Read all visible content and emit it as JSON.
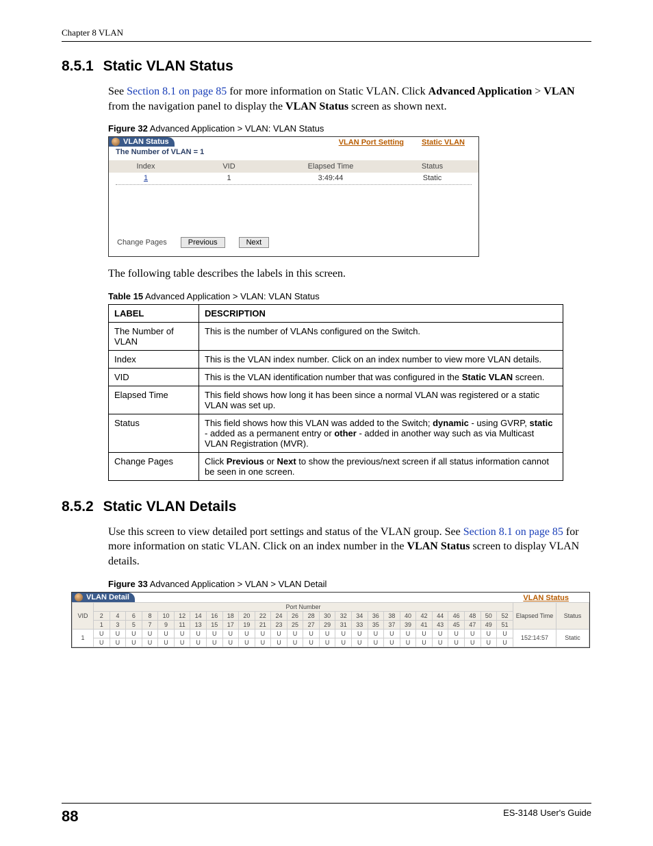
{
  "header": {
    "chapter": "Chapter 8 VLAN"
  },
  "sec851": {
    "num": "8.5.1",
    "title": "Static VLAN Status",
    "para_pre": "See ",
    "link": "Section 8.1 on page 85",
    "para_mid1": " for more information on Static VLAN. Click ",
    "b1": "Advanced Application",
    "gt": " > ",
    "b2": "VLAN",
    "para_mid2": " from the navigation panel to display the ",
    "b3": "VLAN Status",
    "para_end": " screen as shown next."
  },
  "fig32": {
    "caption_b": "Figure 32",
    "caption": "   Advanced Application > VLAN: VLAN Status",
    "tab": "VLAN Status",
    "link1": "VLAN Port Setting",
    "link2": "Static VLAN",
    "subtitle": "The Number of VLAN = 1",
    "headers": {
      "index": "Index",
      "vid": "VID",
      "elapsed": "Elapsed Time",
      "status": "Status"
    },
    "row": {
      "index": "1",
      "vid": "1",
      "elapsed": "3:49:44",
      "status": "Static"
    },
    "change_pages": "Change Pages",
    "prev": "Previous",
    "next": "Next"
  },
  "table15": {
    "intro": "The following table describes the labels in this screen.",
    "caption_b": "Table 15",
    "caption": "   Advanced Application > VLAN: VLAN Status",
    "h1": "LABEL",
    "h2": "DESCRIPTION",
    "rows": [
      {
        "label": "The Number of VLAN",
        "desc_plain": "This is the number of VLANs configured on the Switch."
      },
      {
        "label": "Index",
        "desc_plain": "This is the VLAN index number. Click on an index number to view more VLAN details."
      },
      {
        "label": "VID",
        "desc_pre": "This is the VLAN identification number that was configured in the ",
        "b1": "Static VLAN",
        "desc_post": " screen."
      },
      {
        "label": "Elapsed Time",
        "desc_plain": "This field shows how long it has been since a normal VLAN was registered or a static VLAN was set up."
      },
      {
        "label": "Status",
        "desc_pre": "This field shows how this VLAN was added to the Switch; ",
        "b1": "dynamic",
        "mid1": " - using GVRP, ",
        "b2": "static",
        "mid2": " - added as a permanent entry or ",
        "b3": "other",
        "desc_post": " - added in another way such as via Multicast VLAN Registration (MVR)."
      },
      {
        "label": "Change Pages",
        "desc_pre": "Click ",
        "b1": "Previous",
        "mid1": " or ",
        "b2": "Next",
        "desc_post": " to show the previous/next screen if all status information cannot be seen in one screen."
      }
    ]
  },
  "sec852": {
    "num": "8.5.2",
    "title": "Static VLAN Details",
    "para_pre": "Use this screen to view detailed port settings and status of the VLAN group. See ",
    "link": "Section 8.1 on page 85",
    "para_mid1": " for more information on static VLAN. Click on an index number in the ",
    "b1": "VLAN Status",
    "para_end": " screen to display VLAN details."
  },
  "fig33": {
    "caption_b": "Figure 33",
    "caption": "   Advanced Application > VLAN > VLAN Detail",
    "tab": "VLAN Detail",
    "link": "VLAN Status",
    "port_number": "Port Number",
    "vid_h": "VID",
    "elapsed_h": "Elapsed Time",
    "status_h": "Status",
    "even_ports": [
      "2",
      "4",
      "6",
      "8",
      "10",
      "12",
      "14",
      "16",
      "18",
      "20",
      "22",
      "24",
      "26",
      "28",
      "30",
      "32",
      "34",
      "36",
      "38",
      "40",
      "42",
      "44",
      "46",
      "48",
      "50",
      "52"
    ],
    "odd_ports": [
      "1",
      "3",
      "5",
      "7",
      "9",
      "11",
      "13",
      "15",
      "17",
      "19",
      "21",
      "23",
      "25",
      "27",
      "29",
      "31",
      "33",
      "35",
      "37",
      "39",
      "41",
      "43",
      "45",
      "47",
      "49",
      "51"
    ],
    "row": {
      "vid": "1",
      "cell": "U",
      "elapsed": "152:14:57",
      "status": "Static"
    }
  },
  "footer": {
    "page": "88",
    "guide": "ES-3148 User's Guide"
  }
}
